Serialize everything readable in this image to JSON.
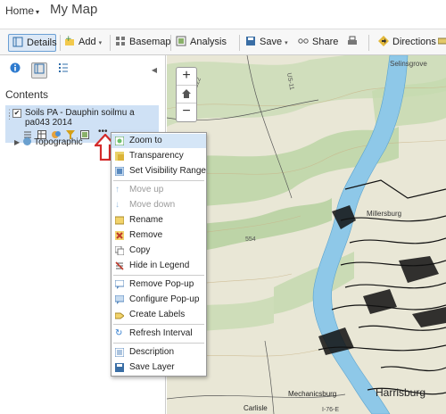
{
  "header": {
    "home_label": "Home",
    "home_caret": "▾",
    "map_title": "My Map"
  },
  "toolbar": {
    "details": "Details",
    "add": "Add",
    "basemap": "Basemap",
    "analysis": "Analysis",
    "save": "Save",
    "share": "Share",
    "directions": "Directions",
    "caret": "▾"
  },
  "sidebar": {
    "contents_title": "Contents",
    "layer": {
      "name": "Soils PA - Dauphin soilmu a pa043 2014",
      "checked": true
    },
    "basemap_row": "Topographic"
  },
  "map_labels": {
    "selinsgrove": "Selinsgrove",
    "harrisburg": "Harrisburg",
    "mechanicsburg": "Mechanicsburg",
    "carlisle": "Carlisle",
    "millersburg": "Millersburg",
    "elev": "554",
    "route_522": "US-522",
    "route_11": "US-11",
    "route_76": "I-76-E"
  },
  "context_menu": {
    "zoom_to": "Zoom to",
    "transparency": "Transparency",
    "visibility": "Set Visibility Range",
    "move_up": "Move up",
    "move_down": "Move down",
    "rename": "Rename",
    "remove": "Remove",
    "copy": "Copy",
    "hide_legend": "Hide in Legend",
    "remove_popup": "Remove Pop-up",
    "configure_popup": "Configure Pop-up",
    "create_labels": "Create Labels",
    "refresh_interval": "Refresh Interval",
    "description": "Description",
    "save_layer": "Save Layer"
  },
  "colors": {
    "accent": "#6a9fd4",
    "highlight": "#d5e6f7",
    "arrow": "#d42a2a",
    "river": "#8ec8e8",
    "forest": "#b9d3a4"
  }
}
